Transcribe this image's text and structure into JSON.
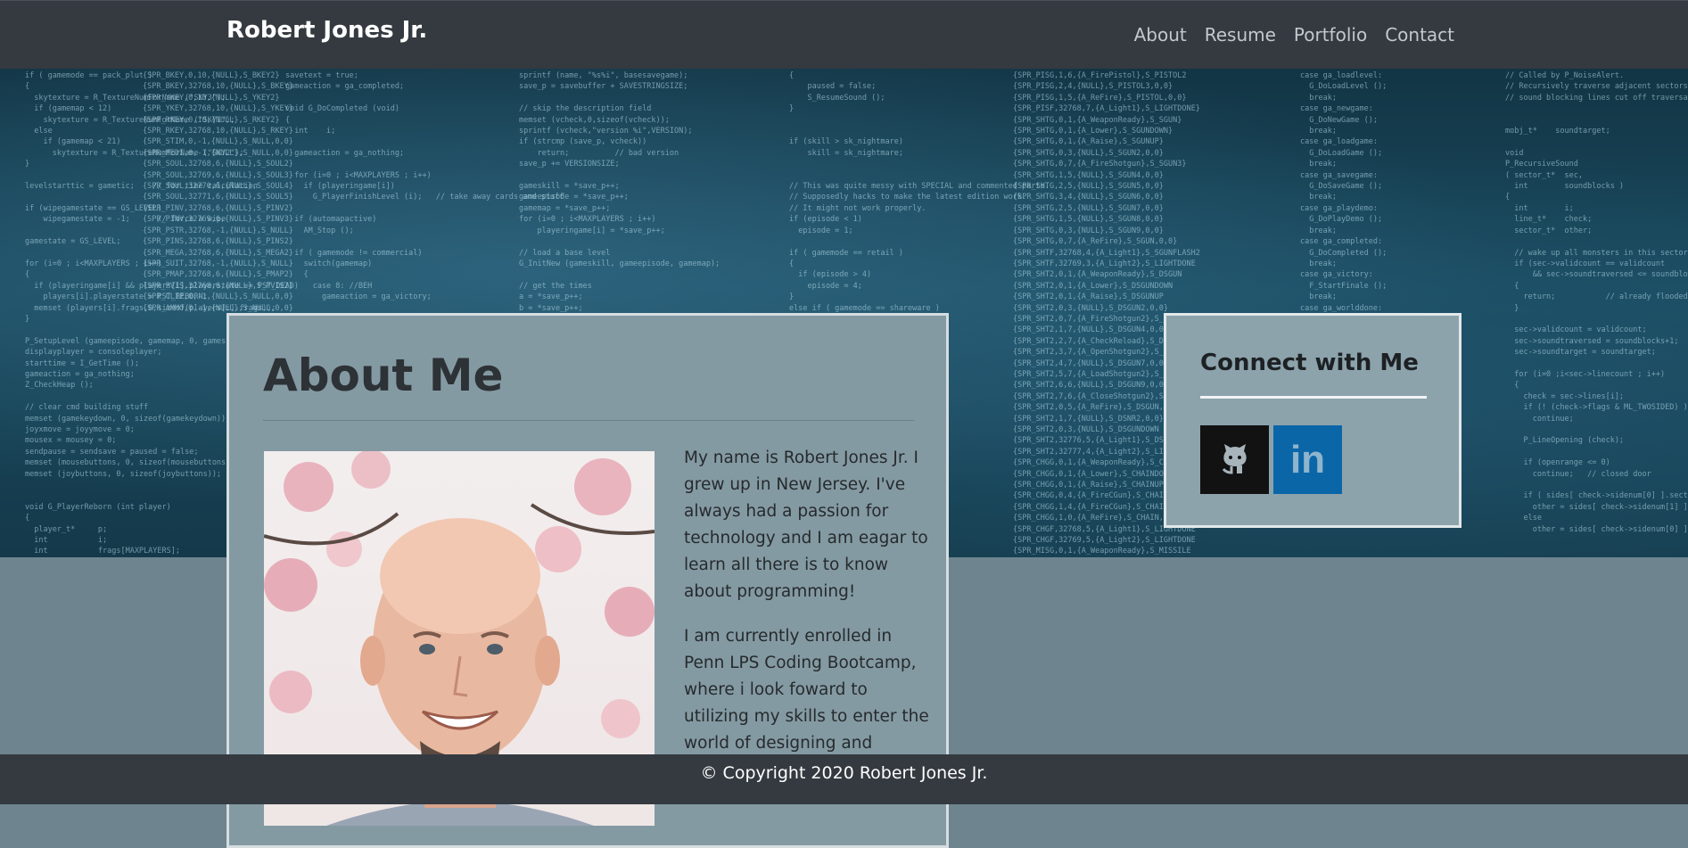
{
  "navbar": {
    "brand": "Robert Jones Jr.",
    "links": [
      "About",
      "Resume",
      "Portfolio",
      "Contact"
    ]
  },
  "hero": {
    "code_columns": [
      "if ( gamemode == pack_plut )\n{\n  skytexture = R_TextureNumForName (\"SKY3\");\n  if (gamemap < 12)\n    skytexture = R_TextureNumForName (\"SKY1\");\n  else\n    if (gamemap < 21)\n      skytexture = R_TextureNumForName (\"SKY2\");\n}\n\nlevelstarttic = gametic;    // for time calculation\n\nif (wipegamestate == GS_LEVEL)\n    wipegamestate = -1;      // force a wipe\n\ngamestate = GS_LEVEL;\n\nfor (i=0 ; i<MAXPLAYERS ; i++)\n{\n  if (playeringame[i] && players[i].playerstate == PST_DEAD)\n    players[i].playerstate = PST_REBORN;\n  memset (players[i].frags,0,sizeof(players[i].frags));\n}\n\nP_SetupLevel (gameepisode, gamemap, 0, gameskill);\ndisplayplayer = consoleplayer;\nstarttime = I_GetTime ();\ngameaction = ga_nothing;\nZ_CheckHeap ();\n\n// clear cmd building stuff\nmemset (gamekeydown, 0, sizeof(gamekeydown));\njoyxmove = joyymove = 0;\nmousex = mousey = 0;\nsendpause = sendsave = paused = false;\nmemset (mousebuttons, 0, sizeof(mousebuttons));\nmemset (joybuttons, 0, sizeof(joybuttons));\n\n\nvoid G_PlayerReborn (int player)\n{\n  player_t*     p;\n  int           i;\n  int           frags[MAXPLAYERS];",
      "{SPR_BKEY,0,10,{NULL},S_BKEY2}\n{SPR_BKEY,32768,10,{NULL},S_BKEY}\n{SPR_YKEY,0,10,{NULL},S_YKEY2}\n{SPR_YKEY,32768,10,{NULL},S_YKEY}\n{SPR_RKEY,0,10,{NULL},S_RKEY2}\n{SPR_RKEY,32768,10,{NULL},S_RKEY}\n{SPR_STIM,0,-1,{NULL},S_NULL,0,0}\n{SPR_MEDI,0,-1,{NULL},S_NULL,0,0}\n{SPR_SOUL,32768,6,{NULL},S_SOUL2}\n{SPR_SOUL,32769,6,{NULL},S_SOUL3}\n{SPR_SOUL,32770,6,{NULL},S_SOUL4}\n{SPR_SOUL,32771,6,{NULL},S_SOUL5}\n{SPR_PINV,32768,6,{NULL},S_PINV2}\n{SPR_PINV,32769,6,{NULL},S_PINV3}\n{SPR_PSTR,32768,-1,{NULL},S_NULL}\n{SPR_PINS,32768,6,{NULL},S_PINS2}\n{SPR_MEGA,32768,6,{NULL},S_MEGA2}\n{SPR_SUIT,32768,-1,{NULL},S_NULL}\n{SPR_PMAP,32768,6,{NULL},S_PMAP2}\n{SPR_PVIS,32768,6,{NULL},S_PVIS2}\n{SPR_CLIP,0,-1,{NULL},S_NULL,0,0}\n{SPR_AMMO,0,-1,{NULL},S_NULL,0,0}",
      "savetext = true;\ngameaction = ga_completed;\n\nvoid G_DoCompleted (void)\n{\n  int    i;\n\n  gameaction = ga_nothing;\n\n  for (i=0 ; i<MAXPLAYERS ; i++)\n    if (playeringame[i])\n      G_PlayerFinishLevel (i);   // take away cards and stuff\n\n  if (automapactive)\n    AM_Stop ();\n\n  if ( gamemode != commercial)\n    switch(gamemap)\n    {\n      case 8: //BEH\n        gameaction = ga_victory;",
      "sprintf (name, \"%s%i\", basesavegame);\nsave_p = savebuffer + SAVESTRINGSIZE;\n\n// skip the description field\nmemset (vcheck,0,sizeof(vcheck));\nsprintf (vcheck,\"version %i\",VERSION);\nif (strcmp (save_p, vcheck))\n    return;          // bad version\nsave_p += VERSIONSIZE;\n\ngameskill = *save_p++;\ngameepisode = *save_p++;\ngamemap = *save_p++;\nfor (i=0 ; i<MAXPLAYERS ; i++)\n    playeringame[i] = *save_p++;\n\n// load a base level\nG_InitNew (gameskill, gameepisode, gamemap);\n\n// get the times\na = *save_p++;\nb = *save_p++;\nc = *save_p++;",
      "{\n    paused = false;\n    S_ResumeSound ();\n}\n\n\nif (skill > sk_nightmare)\n    skill = sk_nightmare;\n\n\n// This was quite messy with SPECIAL and commented parts.\n// Supposedly hacks to make the latest edition work.\n// It might not work properly.\nif (episode < 1)\n  episode = 1;\n\nif ( gamemode == retail )\n{\n  if (episode > 4)\n    episode = 4;\n}\nelse if ( gamemode == shareware )",
      "{SPR_PISG,1,6,{A_FirePistol},S_PISTOL2\n{SPR_PISG,2,4,{NULL},S_PISTOL3,0,0}\n{SPR_PISG,1,5,{A_ReFire},S_PISTOL,0,0}\n{SPR_PISF,32768,7,{A_Light1},S_LIGHTDONE}\n{SPR_SHTG,0,1,{A_WeaponReady},S_SGUN}\n{SPR_SHTG,0,1,{A_Lower},S_SGUNDOWN}\n{SPR_SHTG,0,1,{A_Raise},S_SGUNUP}\n{SPR_SHTG,0,3,{NULL},S_SGUN2,0,0}\n{SPR_SHTG,0,7,{A_FireShotgun},S_SGUN3}\n{SPR_SHTG,1,5,{NULL},S_SGUN4,0,0}\n{SPR_SHTG,2,5,{NULL},S_SGUN5,0,0}\n{SPR_SHTG,3,4,{NULL},S_SGUN6,0,0}\n{SPR_SHTG,2,5,{NULL},S_SGUN7,0,0}\n{SPR_SHTG,1,5,{NULL},S_SGUN8,0,0}\n{SPR_SHTG,0,3,{NULL},S_SGUN9,0,0}\n{SPR_SHTG,0,7,{A_ReFire},S_SGUN,0,0}\n{SPR_SHTF,32768,4,{A_Light1},S_SGUNFLASH2\n{SPR_SHTF,32769,3,{A_Light2},S_LIGHTDONE\n{SPR_SHT2,0,1,{A_WeaponReady},S_DSGUN\n{SPR_SHT2,0,1,{A_Lower},S_DSGUNDOWN\n{SPR_SHT2,0,1,{A_Raise},S_DSGUNUP\n{SPR_SHT2,0,3,{NULL},S_DSGUN2,0,0}\n{SPR_SHT2,0,7,{A_FireShotgun2},S_DSGUN3\n{SPR_SHT2,1,7,{NULL},S_DSGUN4,0,0}\n{SPR_SHT2,2,7,{A_CheckReload},S_DSGUN5\n{SPR_SHT2,3,7,{A_OpenShotgun2},S_DSGUN6\n{SPR_SHT2,4,7,{NULL},S_DSGUN7,0,0}\n{SPR_SHT2,5,7,{A_LoadShotgun2},S_DSGUN8\n{SPR_SHT2,6,6,{NULL},S_DSGUN9,0,0}\n{SPR_SHT2,7,6,{A_CloseShotgun2},S_DSGUN10\n{SPR_SHT2,0,5,{A_ReFire},S_DSGUN,0,0}\n{SPR_SHT2,1,7,{NULL},S_DSNR2,0,0}\n{SPR_SHT2,0,3,{NULL},S_DSGUNDOWN\n{SPR_SHT2,32776,5,{A_Light1},S_DSGUNFLASH2\n{SPR_SHT2,32777,4,{A_Light2},S_LIGHTDONE\n{SPR_CHGG,0,1,{A_WeaponReady},S_CHAIN\n{SPR_CHGG,0,1,{A_Lower},S_CHAINDOWN\n{SPR_CHGG,0,1,{A_Raise},S_CHAINUP\n{SPR_CHGG,0,4,{A_FireCGun},S_CHAIN2\n{SPR_CHGG,1,4,{A_FireCGun},S_CHAIN3\n{SPR_CHGG,1,0,{A_ReFire},S_CHAIN,0,0}\n{SPR_CHGF,32768,5,{A_Light1},S_LIGHTDONE\n{SPR_CHGF,32769,5,{A_Light2},S_LIGHTDONE\n{SPR_MISG,0,1,{A_WeaponReady},S_MISSILE\n{SPR_MISG,0,1,{A_Lower},S_MISSILEDOWN",
      "case ga_loadlevel:\n  G_DoLoadLevel ();\n  break;\ncase ga_newgame:\n  G_DoNewGame ();\n  break;\ncase ga_loadgame:\n  G_DoLoadGame ();\n  break;\ncase ga_savegame:\n  G_DoSaveGame ();\n  break;\ncase ga_playdemo:\n  G_DoPlayDemo ();\n  break;\ncase ga_completed:\n  G_DoCompleted ();\n  break;\ncase ga_victory:\n  F_StartFinale ();\n  break;\ncase ga_worlddone:\n  G_DoWorldDone ();\n  break;\ncase ga_screenshot:\n  M_ScreenShot ();\n  gameaction = ga_nothing;\n  break;",
      "// Called by P_NoiseAlert.\n// Recursively traverse adjacent sectors,\n// sound blocking lines cut off traversal.\n\n\nmobj_t*    soundtarget;\n\nvoid\nP_RecursiveSound\n( sector_t*  sec,\n  int        soundblocks )\n{\n  int        i;\n  line_t*    check;\n  sector_t*  other;\n\n  // wake up all monsters in this sector\n  if (sec->validcount == validcount\n      && sec->soundtraversed <= soundblocks+1)\n  {\n    return;           // already flooded\n  }\n\n  sec->validcount = validcount;\n  sec->soundtraversed = soundblocks+1;\n  sec->soundtarget = soundtarget;\n\n  for (i=0 ;i<sec->linecount ; i++)\n  {\n    check = sec->lines[i];\n    if (! (check->flags & ML_TWOSIDED) )\n      continue;\n\n    P_LineOpening (check);\n\n    if (openrange <= 0)\n      continue;   // closed door\n\n    if ( sides[ check->sidenum[0] ].sector == sec)\n      other = sides[ check->sidenum[1] ] .sector;\n    else\n      other = sides[ check->sidenum[0] ].sector;"
    ]
  },
  "about": {
    "title": "About Me",
    "paragraphs": [
      "My name is Robert Jones Jr. I grew up in New Jersey. I've always had a passion for technology and I am eagar to learn all there is to know about programming!",
      "I am currently enrolled in Penn LPS Coding Bootcamp, where i look foward to utilizing my skills to enter the world of designing and"
    ]
  },
  "connect": {
    "title": "Connect with Me",
    "links": [
      {
        "icon": "github-icon",
        "color": "#121212"
      },
      {
        "icon": "linkedin-icon",
        "color": "#0b66a8",
        "text": "in"
      }
    ]
  },
  "footer": {
    "copyright": "© Copyright 2020 Robert Jones Jr."
  }
}
